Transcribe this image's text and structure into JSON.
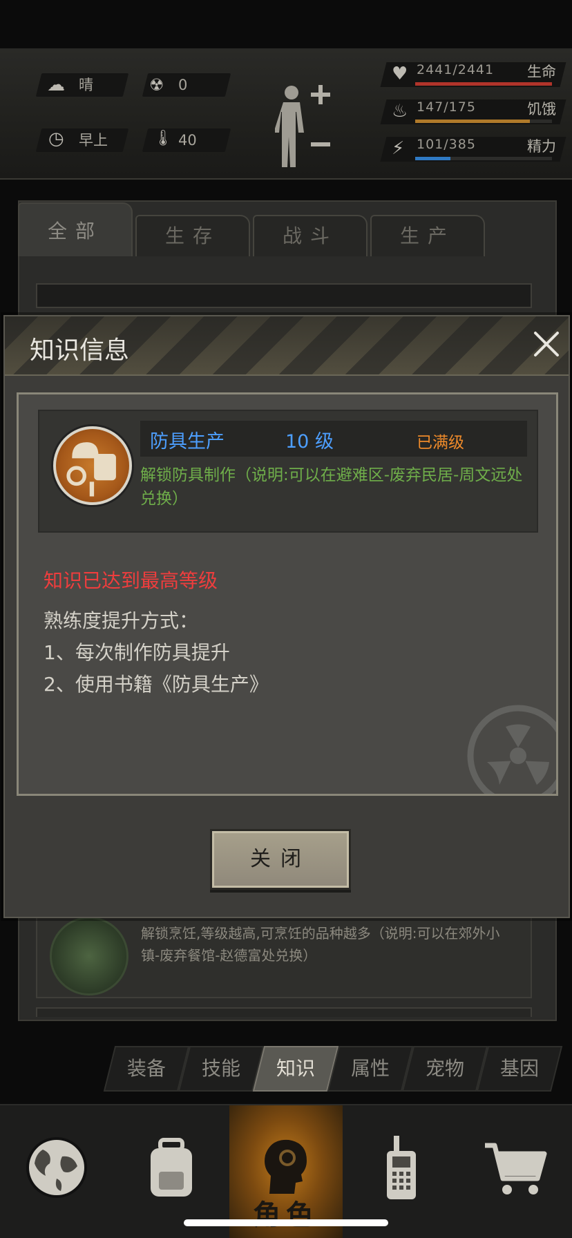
{
  "status": {
    "weather": {
      "icon": "cloud-sun-icon",
      "label": "晴"
    },
    "radiation": {
      "icon": "radiation-icon",
      "value": "0"
    },
    "time": {
      "icon": "clock-icon",
      "label": "早上"
    },
    "temperature": {
      "icon": "thermometer-icon",
      "value": "40"
    },
    "stats": [
      {
        "icon": "heartbeat-icon",
        "value": "2441/2441",
        "label": "生命",
        "fill": 1.0,
        "color": "#b0342a"
      },
      {
        "icon": "stomach-icon",
        "value": "147/175",
        "label": "饥饿",
        "fill": 0.84,
        "color": "#b07a2a"
      },
      {
        "icon": "energy-icon",
        "value": "101/385",
        "label": "精力",
        "fill": 0.26,
        "color": "#2f7ac4"
      }
    ]
  },
  "tabs": [
    {
      "label": "全部",
      "active": true
    },
    {
      "label": "生存",
      "active": false
    },
    {
      "label": "战斗",
      "active": false
    },
    {
      "label": "生产",
      "active": false
    }
  ],
  "background_card": {
    "desc": "解锁烹饪,等级越高,可烹饪的品种越多（说明:可以在郊外小镇-废弃餐馆-赵德富处兑换）"
  },
  "modal": {
    "title": "知识信息",
    "item": {
      "name": "防具生产",
      "level": "10 级",
      "status": "已满级",
      "desc": "解锁防具制作（说明:可以在避难区-废弃民居-周文远处兑换）"
    },
    "notice": "知识已达到最高等级",
    "method_heading": "熟练度提升方式：",
    "methods": [
      "1、每次制作防具提升",
      "2、使用书籍《防具生产》"
    ],
    "close_label": "关闭"
  },
  "subtabs": [
    {
      "label": "装备",
      "active": false
    },
    {
      "label": "技能",
      "active": false
    },
    {
      "label": "知识",
      "active": true
    },
    {
      "label": "属性",
      "active": false
    },
    {
      "label": "宠物",
      "active": false
    },
    {
      "label": "基因",
      "active": false
    }
  ],
  "bottom_nav": [
    {
      "icon": "globe-icon",
      "label": ""
    },
    {
      "icon": "backpack-icon",
      "label": ""
    },
    {
      "icon": "character-head-icon",
      "label": "角色",
      "active": true
    },
    {
      "icon": "walkie-talkie-icon",
      "label": ""
    },
    {
      "icon": "cart-icon",
      "label": ""
    }
  ]
}
